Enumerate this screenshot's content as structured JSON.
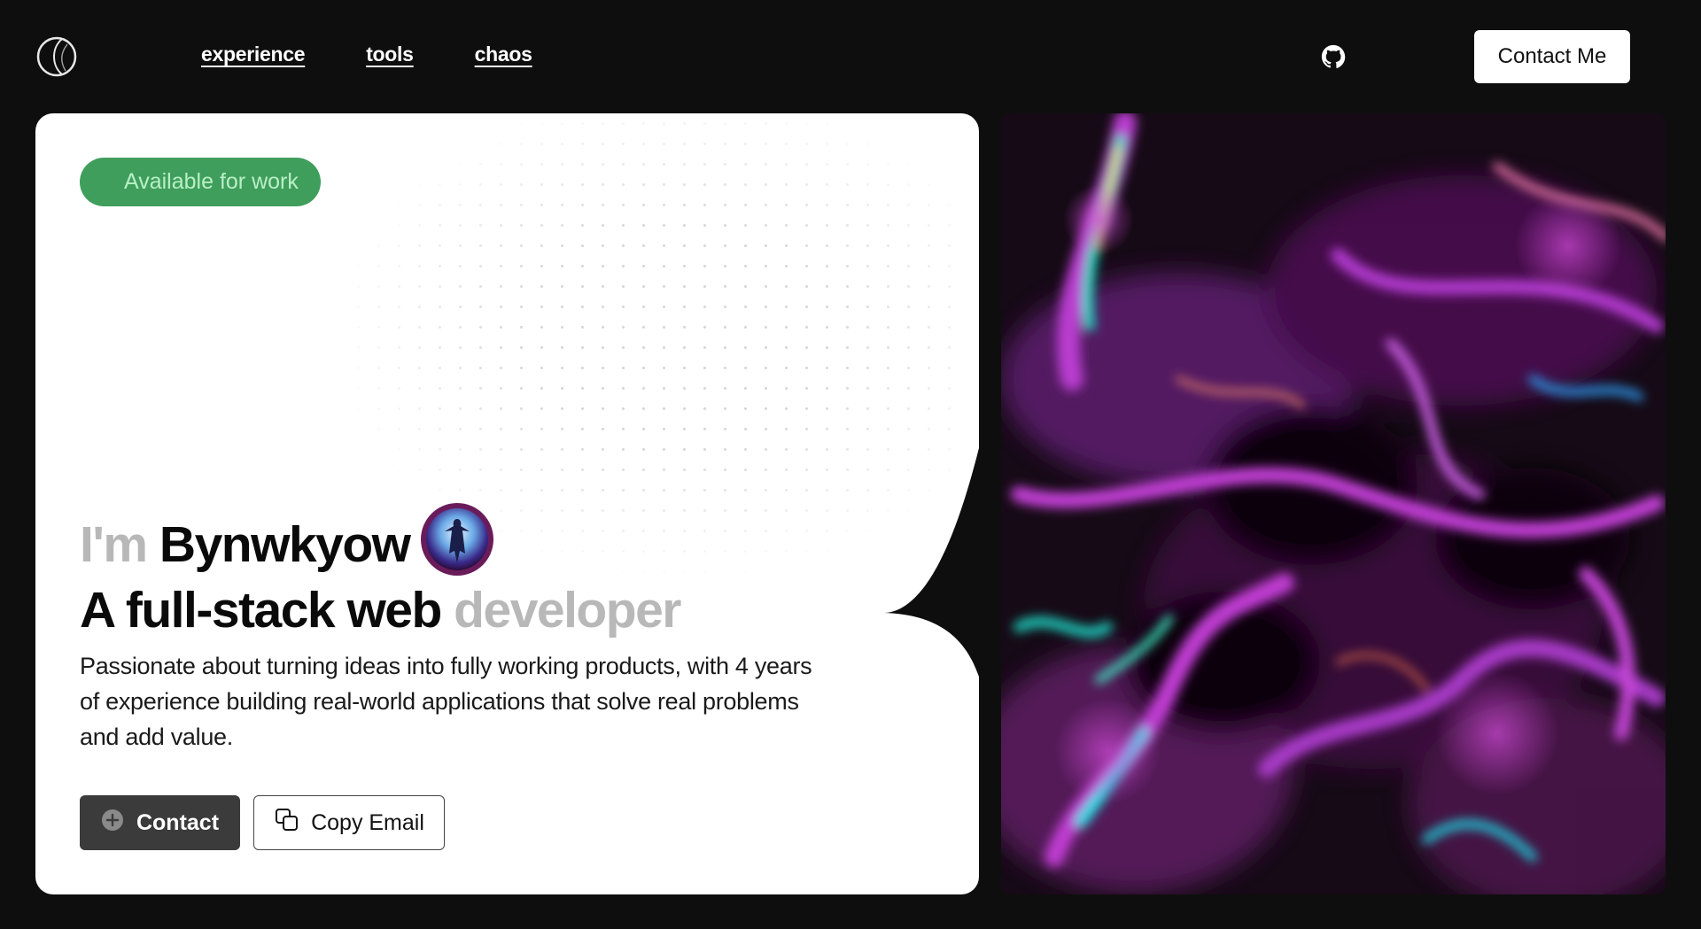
{
  "header": {
    "logo_icon": "circle-logo-icon",
    "nav": [
      {
        "label": "experience"
      },
      {
        "label": "tools"
      },
      {
        "label": "chaos"
      }
    ],
    "github_icon": "github-icon",
    "contact_label": "Contact Me"
  },
  "hero": {
    "badge": "Available for work",
    "intro_prefix": "I'm",
    "name": "Bynwkyow",
    "role_main": "A full-stack web",
    "role_muted": "developer",
    "description": "Passionate about turning ideas into fully working products, with 4 years of experience building real-world applications that solve real problems and add value.",
    "contact_button": "Contact",
    "copy_email_button": "Copy Email"
  },
  "colors": {
    "background": "#0e0e0e",
    "card": "#ffffff",
    "badge_bg": "#3f9e5c",
    "badge_text": "#b9efc6",
    "muted_text": "#b8b8b8",
    "contact_button_bg": "#3b3b3b",
    "art_base": "#140812",
    "art_magenta": "#b030c8",
    "art_cyan": "#00e5d0"
  }
}
